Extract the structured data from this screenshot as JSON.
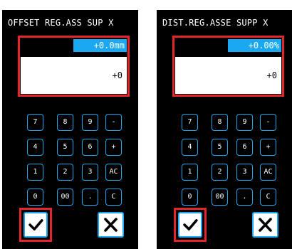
{
  "panels": [
    {
      "title": "OFFSET REG.ASS SUP X",
      "current_value": "+0.0mm",
      "input_value": "+0",
      "keys": [
        [
          "7",
          "8",
          "9",
          "-"
        ],
        [
          "4",
          "5",
          "6",
          "+"
        ],
        [
          "1",
          "2",
          "3",
          "AC"
        ],
        [
          "0",
          "00",
          ".",
          "C"
        ]
      ],
      "ok_icon": "checkmark-icon",
      "cancel_icon": "x-icon"
    },
    {
      "title": "DIST.REG.ASSE SUPP X",
      "current_value": "+0.00%",
      "input_value": "+0",
      "keys": [
        [
          "7",
          "8",
          "9",
          "-"
        ],
        [
          "4",
          "5",
          "6",
          "+"
        ],
        [
          "1",
          "2",
          "3",
          "AC"
        ],
        [
          "0",
          "00",
          ".",
          "C"
        ]
      ],
      "ok_icon": "checkmark-icon",
      "cancel_icon": "x-icon"
    }
  ],
  "colors": {
    "accent": "#1aa8f2",
    "highlight": "#e3262c",
    "background": "#000000"
  }
}
